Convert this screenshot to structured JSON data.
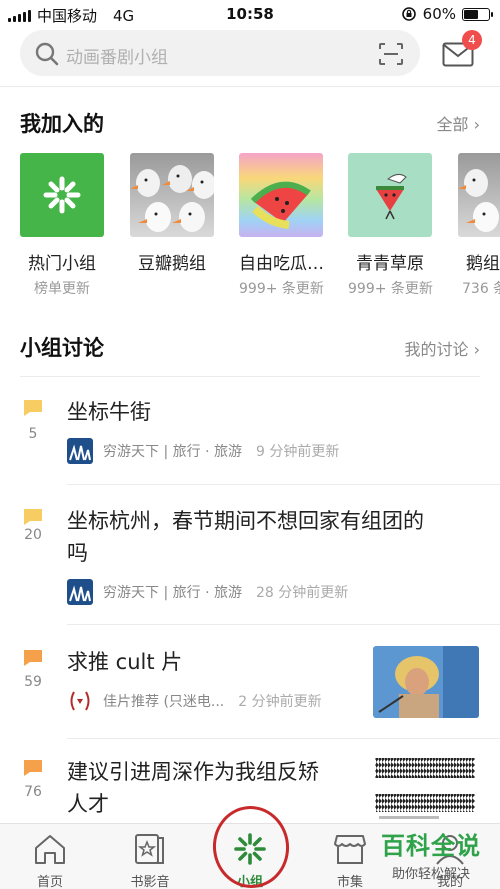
{
  "status_bar": {
    "carrier": "中国移动",
    "network": "4G",
    "time": "10:58",
    "battery": "60%",
    "battery_level": 0.6
  },
  "search": {
    "placeholder": "动画番剧小组"
  },
  "mail": {
    "badge": "4"
  },
  "joined": {
    "title": "我加入的",
    "link": "全部 ›",
    "groups": [
      {
        "name": "热门小组",
        "sub": "榜单更新"
      },
      {
        "name": "豆瓣鹅组",
        "sub": ""
      },
      {
        "name": "自由吃瓜…",
        "sub": "999+ 条更新"
      },
      {
        "name": "青青草原",
        "sub": "999+ 条更新"
      },
      {
        "name": "鹅组",
        "sub": "736 条"
      }
    ]
  },
  "discussion": {
    "title": "小组讨论",
    "link": "我的讨论 ›",
    "threads": [
      {
        "count": "5",
        "title": [
          "坐标牛街"
        ],
        "group": "穷游天下 | 旅行 · 旅游",
        "time": "9 分钟前更新"
      },
      {
        "count": "20",
        "title": [
          "坐标杭州，春节期间不想回家有组团的",
          "吗"
        ],
        "group": "穷游天下 | 旅行 · 旅游",
        "time": "28 分钟前更新"
      },
      {
        "count": "59",
        "title": [
          "求推 cult 片"
        ],
        "group": "佳片推荐  (只迷电...",
        "time": "2 分钟前更新"
      },
      {
        "count": "76",
        "title": [
          "建议引进周深作为我组反矫",
          "人才"
        ],
        "group": "",
        "time": ""
      }
    ]
  },
  "bottom_nav": [
    {
      "label": "首页"
    },
    {
      "label": "书影音"
    },
    {
      "label": "小组"
    },
    {
      "label": "市集"
    },
    {
      "label": "我的"
    }
  ],
  "watermark": {
    "title": "百科全说",
    "sub": "助你轻松解决"
  },
  "colors": {
    "accent_green": "#2e8b3a",
    "badge_red": "#f04d4d",
    "flag_yellow": "#f7cc63",
    "flag_orange": "#f5a04a"
  }
}
